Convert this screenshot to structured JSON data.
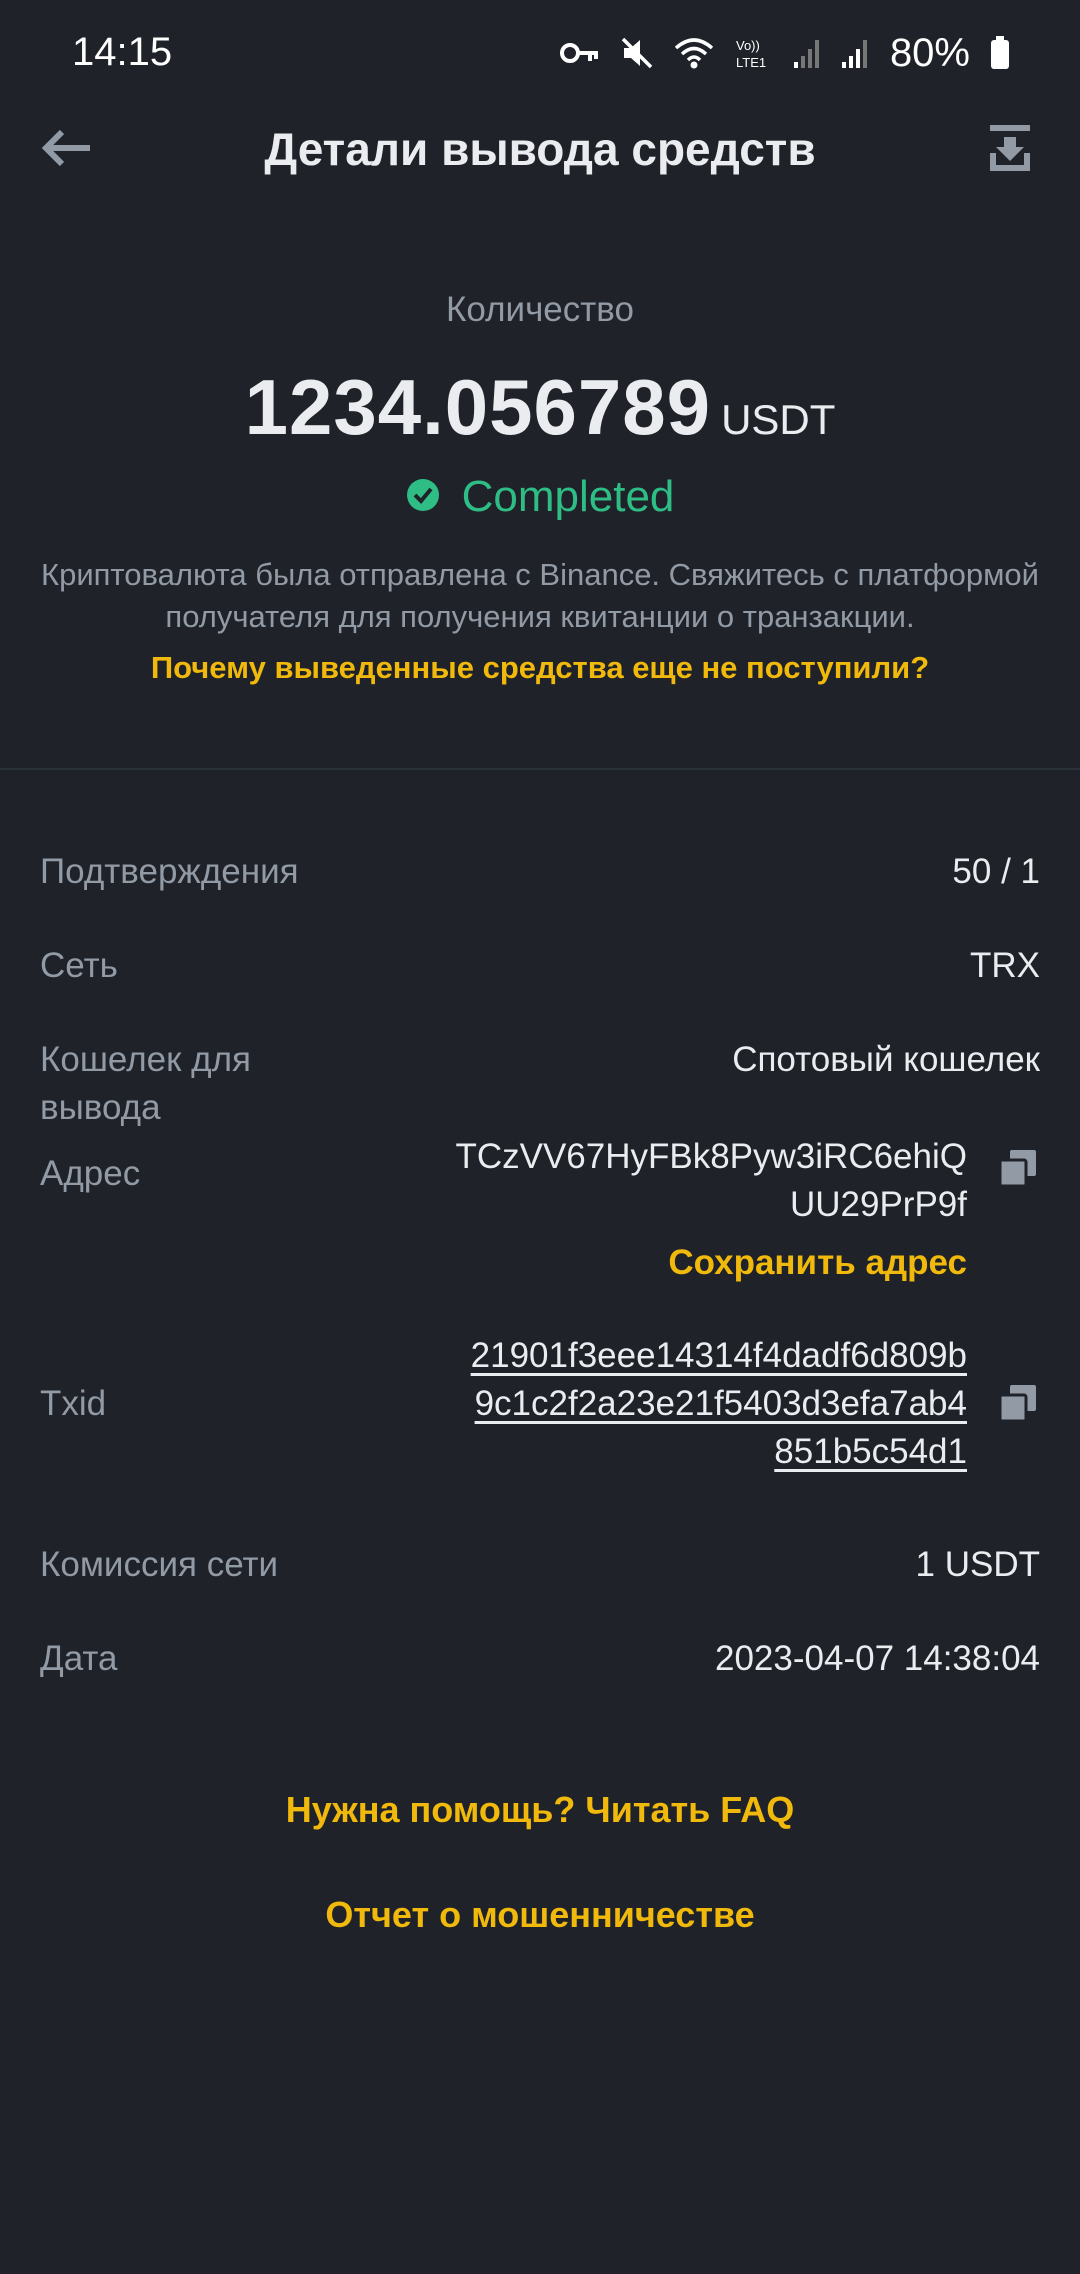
{
  "status_bar": {
    "time": "14:15",
    "battery": "80%",
    "icons": [
      "vpn-key-icon",
      "mute-icon",
      "wifi-icon",
      "volte-icon",
      "signal-icon",
      "signal-icon",
      "battery-icon"
    ],
    "volte_label": "Vo))\nLTE1"
  },
  "header": {
    "title": "Детали вывода средств",
    "back_icon": "arrow-left-icon",
    "download_icon": "download-icon"
  },
  "summary": {
    "amount_label": "Количество",
    "amount": "1234.056789",
    "currency": "USDT",
    "status": "Completed",
    "status_icon": "check-circle-icon",
    "info": "Криптовалюта была отправлена с Binance. Свяжитесь с платформой получателя для получения квитанции о транзакции.",
    "why_link": "Почему выведенные средства еще не поступили?"
  },
  "details": {
    "confirmations": {
      "label": "Подтверждения",
      "value": "50 / 1"
    },
    "network": {
      "label": "Сеть",
      "value": "TRX"
    },
    "wallet": {
      "label": "Кошелек для вывода",
      "value": "Спотовый кошелек"
    },
    "address": {
      "label": "Адрес",
      "value_line1": "TCzVV67HyFBk8Pyw3iRC6ehiQ",
      "value_line2": "UU29PrP9f",
      "save_label": "Сохранить адрес"
    },
    "txid": {
      "label": "Txid",
      "line1": "21901f3eee14314f4dadf6d809b",
      "line2": "9c1c2f2a23e21f5403d3efa7ab4",
      "line3": "851b5c54d1"
    },
    "fee": {
      "label": "Комиссия сети",
      "value": "1 USDT"
    },
    "date": {
      "label": "Дата",
      "value": "2023-04-07 14:38:04"
    }
  },
  "footer": {
    "faq_link": "Нужна помощь? Читать FAQ",
    "fraud_link": "Отчет о мошенничестве"
  },
  "colors": {
    "background": "#1f2329",
    "accent": "#f0b90b",
    "success": "#2ebd85",
    "muted_text": "#929aa5",
    "primary_text": "#eaecef"
  }
}
